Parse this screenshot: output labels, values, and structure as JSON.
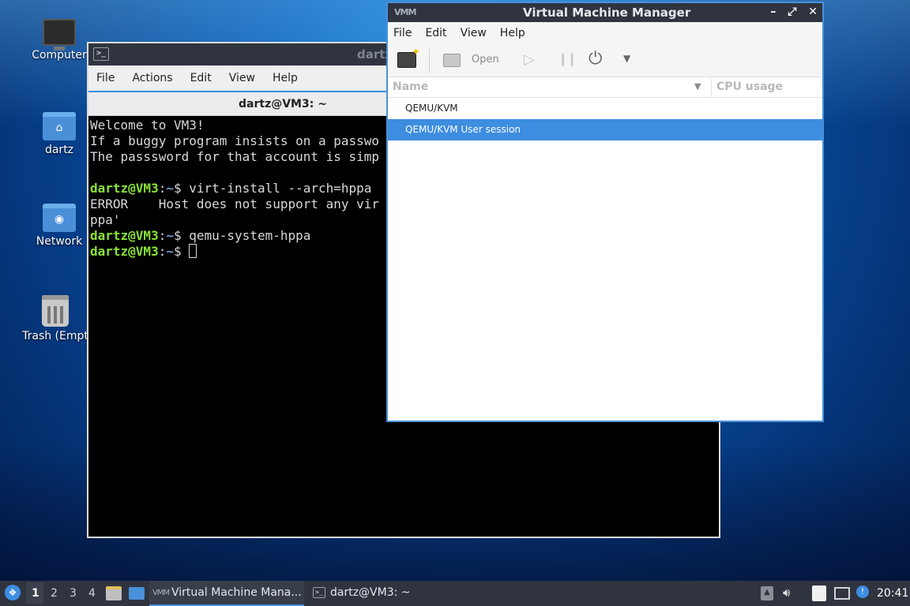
{
  "desktop": {
    "icons": [
      {
        "label": "Computer"
      },
      {
        "label": "dartz"
      },
      {
        "label": "Network"
      },
      {
        "label": "Trash (Empt"
      }
    ]
  },
  "terminal": {
    "title": "dartz",
    "menu": [
      "File",
      "Actions",
      "Edit",
      "View",
      "Help"
    ],
    "tab_title": "dartz@VM3: ~",
    "lines": {
      "l1": "Welcome to VM3!",
      "l2": "If a buggy program insists on a passwo",
      "l3": "The passsword for that account is simp",
      "l5_prompt_user": "dartz@VM3",
      "l5_prompt_path": "~",
      "l5_cmd": "$ virt-install --arch=hppa",
      "l6": "ERROR    Host does not support any vir",
      "l7": "ppa'",
      "l8_prompt_user": "dartz@VM3",
      "l8_prompt_path": "~",
      "l8_cmd": "$ qemu-system-hppa",
      "l9_prompt_user": "dartz@VM3",
      "l9_prompt_path": "~",
      "l9_cmd": "$ "
    }
  },
  "vmm": {
    "title": "Virtual Machine Manager",
    "window_controls": {
      "minimize": "–",
      "maximize": "⤢",
      "close": "✕"
    },
    "menu": [
      "File",
      "Edit",
      "View",
      "Help"
    ],
    "toolbar": {
      "open_label": "Open"
    },
    "columns": {
      "name": "Name",
      "cpu": "CPU usage"
    },
    "rows": [
      {
        "label": "QEMU/KVM",
        "selected": false
      },
      {
        "label": "QEMU/KVM User session",
        "selected": true
      }
    ],
    "accent_color": "#3d8de0"
  },
  "taskbar": {
    "workspaces": [
      "1",
      "2",
      "3",
      "4"
    ],
    "active_workspace": "1",
    "tasks": [
      {
        "label": "Virtual Machine Mana...",
        "active": true
      },
      {
        "label": "dartz@VM3: ~",
        "active": false
      }
    ],
    "clock": "20:41",
    "icons": [
      "start-menu-icon",
      "file-manager-icon",
      "show-desktop-icon",
      "volume-icon",
      "clipboard-icon",
      "network-icon",
      "notification-icon"
    ]
  }
}
